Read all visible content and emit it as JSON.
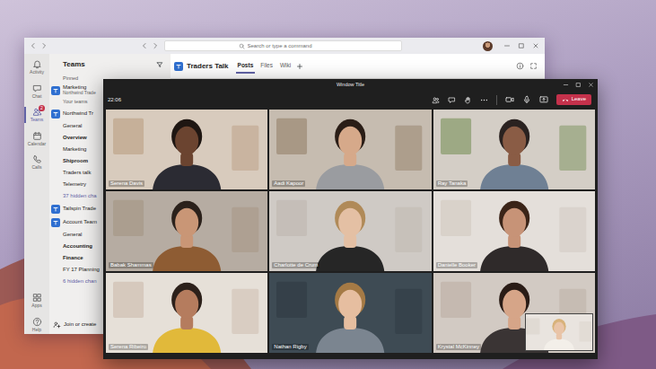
{
  "teams_window": {
    "search": {
      "placeholder": "Search or type a command"
    },
    "rail": [
      {
        "label": "Activity",
        "selected": false
      },
      {
        "label": "Chat",
        "selected": false
      },
      {
        "label": "Teams",
        "selected": true,
        "badge": "2"
      },
      {
        "label": "Calendar",
        "selected": false
      },
      {
        "label": "Calls",
        "selected": false
      }
    ],
    "rail_bottom": [
      {
        "label": "Apps"
      },
      {
        "label": "Help"
      }
    ],
    "panel": {
      "title": "Teams",
      "items": [
        {
          "kind": "heading",
          "label": "Pinned"
        },
        {
          "kind": "team",
          "label": "Marketing",
          "subtitle": "Northwind Trade"
        },
        {
          "kind": "heading",
          "label": "Your teams"
        },
        {
          "kind": "team",
          "label": "Northwind Tr"
        },
        {
          "kind": "channel",
          "label": "General",
          "unread": false
        },
        {
          "kind": "channel",
          "label": "Overview",
          "unread": true
        },
        {
          "kind": "channel",
          "label": "Marketing",
          "unread": false
        },
        {
          "kind": "channel",
          "label": "Shiproom",
          "unread": true
        },
        {
          "kind": "channel",
          "label": "Traders talk",
          "unread": false
        },
        {
          "kind": "channel",
          "label": "Telemetry",
          "unread": false
        },
        {
          "kind": "hidden",
          "label": "37 hidden cha"
        },
        {
          "kind": "team",
          "label": "Tailspin Trade"
        },
        {
          "kind": "team",
          "label": "Account Team"
        },
        {
          "kind": "channel",
          "label": "General",
          "unread": false
        },
        {
          "kind": "channel",
          "label": "Accounting",
          "unread": true
        },
        {
          "kind": "channel",
          "label": "Finance",
          "unread": true
        },
        {
          "kind": "channel",
          "label": "FY 17 Planning",
          "unread": false
        },
        {
          "kind": "hidden",
          "label": "6 hidden chan"
        }
      ],
      "join": "Join or create"
    },
    "channel_header": {
      "title": "Traders Talk",
      "tabs": [
        {
          "label": "Posts",
          "selected": true
        },
        {
          "label": "Files",
          "selected": false
        },
        {
          "label": "Wiki",
          "selected": false
        }
      ]
    }
  },
  "call_window": {
    "title": "Window Title",
    "time": "22:06",
    "leave": "Leave",
    "participants": [
      {
        "name": "Serena Davis"
      },
      {
        "name": "Aadi Kapoor"
      },
      {
        "name": "Ray Tanaka"
      },
      {
        "name": "Babak Shammas"
      },
      {
        "name": "Charlotte de Crum"
      },
      {
        "name": "Danielle Booker"
      },
      {
        "name": "Serena Ribeiro"
      },
      {
        "name": "Nathan Rigby"
      },
      {
        "name": "Krystal McKinney"
      }
    ]
  }
}
